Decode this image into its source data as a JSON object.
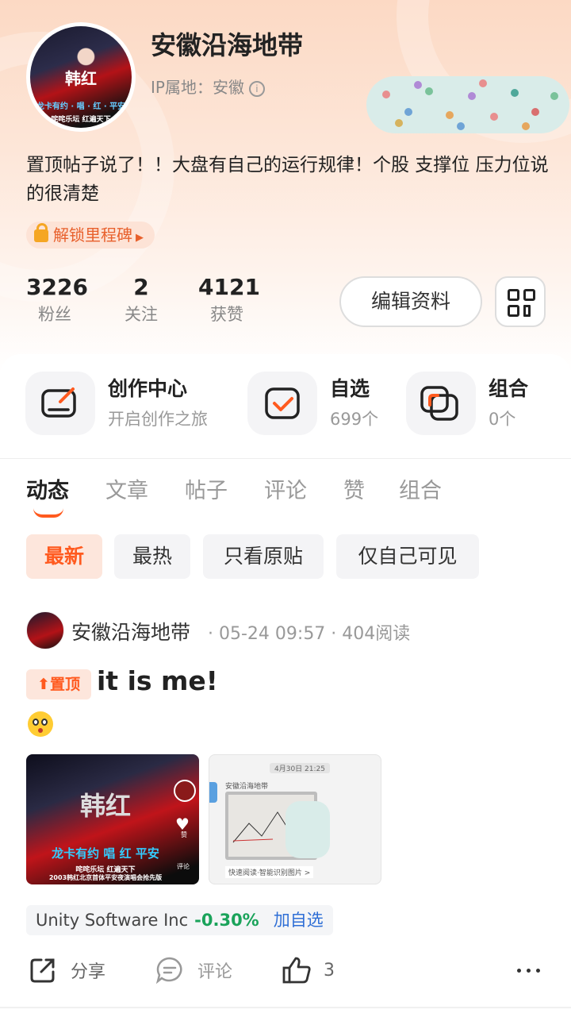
{
  "profile": {
    "name": "安徽沿海地带",
    "ip_label": "IP属地：安徽",
    "bio": "置顶帖子说了！！大盘有自己的运行规律！个股 支撑位 压力位说的很清楚",
    "milestone_label": "解锁里程碑",
    "avatar_text_1": "韩红",
    "avatar_text_2": "龙卡有约 · 唱 · 红 · 平安",
    "avatar_text_3": "咤咤乐坛   红遍天下"
  },
  "stats": [
    {
      "value": "3226",
      "label": "粉丝"
    },
    {
      "value": "2",
      "label": "关注"
    },
    {
      "value": "4121",
      "label": "获赞"
    }
  ],
  "actions": {
    "edit_label": "编辑资料"
  },
  "tools": [
    {
      "title": "创作中心",
      "subtitle": "开启创作之旅"
    },
    {
      "title": "自选",
      "subtitle": "699个"
    },
    {
      "title": "组合",
      "subtitle": "0个"
    }
  ],
  "tabs": [
    "动态",
    "文章",
    "帖子",
    "评论",
    "赞",
    "组合"
  ],
  "filters": [
    "最新",
    "最热",
    "只看原贴",
    "仅自己可见"
  ],
  "post": {
    "author": "安徽沿海地带",
    "meta": "· 05-24 09:57 · 404阅读",
    "pin_label": "置顶",
    "title": "it is me!",
    "image1_caption_1": "韩红",
    "image1_caption_2": "龙卡有约  唱  红  平安",
    "image1_caption_3": "咤咤乐坛    红遍天下",
    "image1_caption_4": "2003韩红北京首体平安夜演唱会抢先版",
    "image1_like": "赞",
    "image1_comment": "评论",
    "image2_time": "4月30日 21:25",
    "image2_sender": "安徽沿海地带",
    "image2_footer": "快速阅读·智能识别图片 >",
    "stock_name": "Unity Software Inc",
    "stock_change": "-0.30%",
    "stock_add": "加自选",
    "share_label": "分享",
    "comment_label": "评论",
    "like_count": "3"
  },
  "colors": {
    "accent": "#ff5a1f",
    "stock_down": "#1aa35a",
    "link": "#2f6fd6"
  }
}
